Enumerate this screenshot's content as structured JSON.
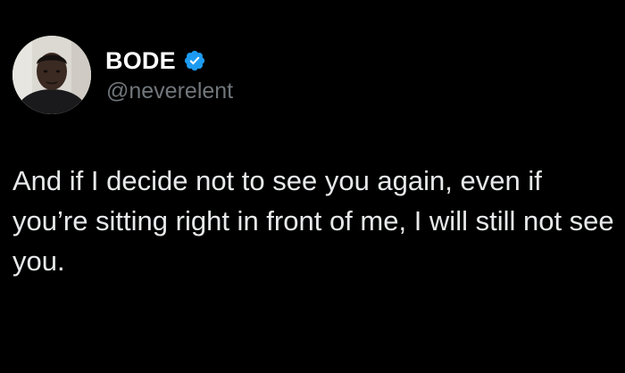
{
  "author": {
    "display_name": "BODE",
    "handle": "@neverelent",
    "verified": true
  },
  "tweet": {
    "text": "And if I decide not to see you again, even if you’re sitting right in front of me, I will still not see you."
  },
  "colors": {
    "background": "#000000",
    "name": "#ffffff",
    "handle": "#71767b",
    "body_text": "#e7e9ea",
    "verified_badge": "#1d9bf0"
  }
}
